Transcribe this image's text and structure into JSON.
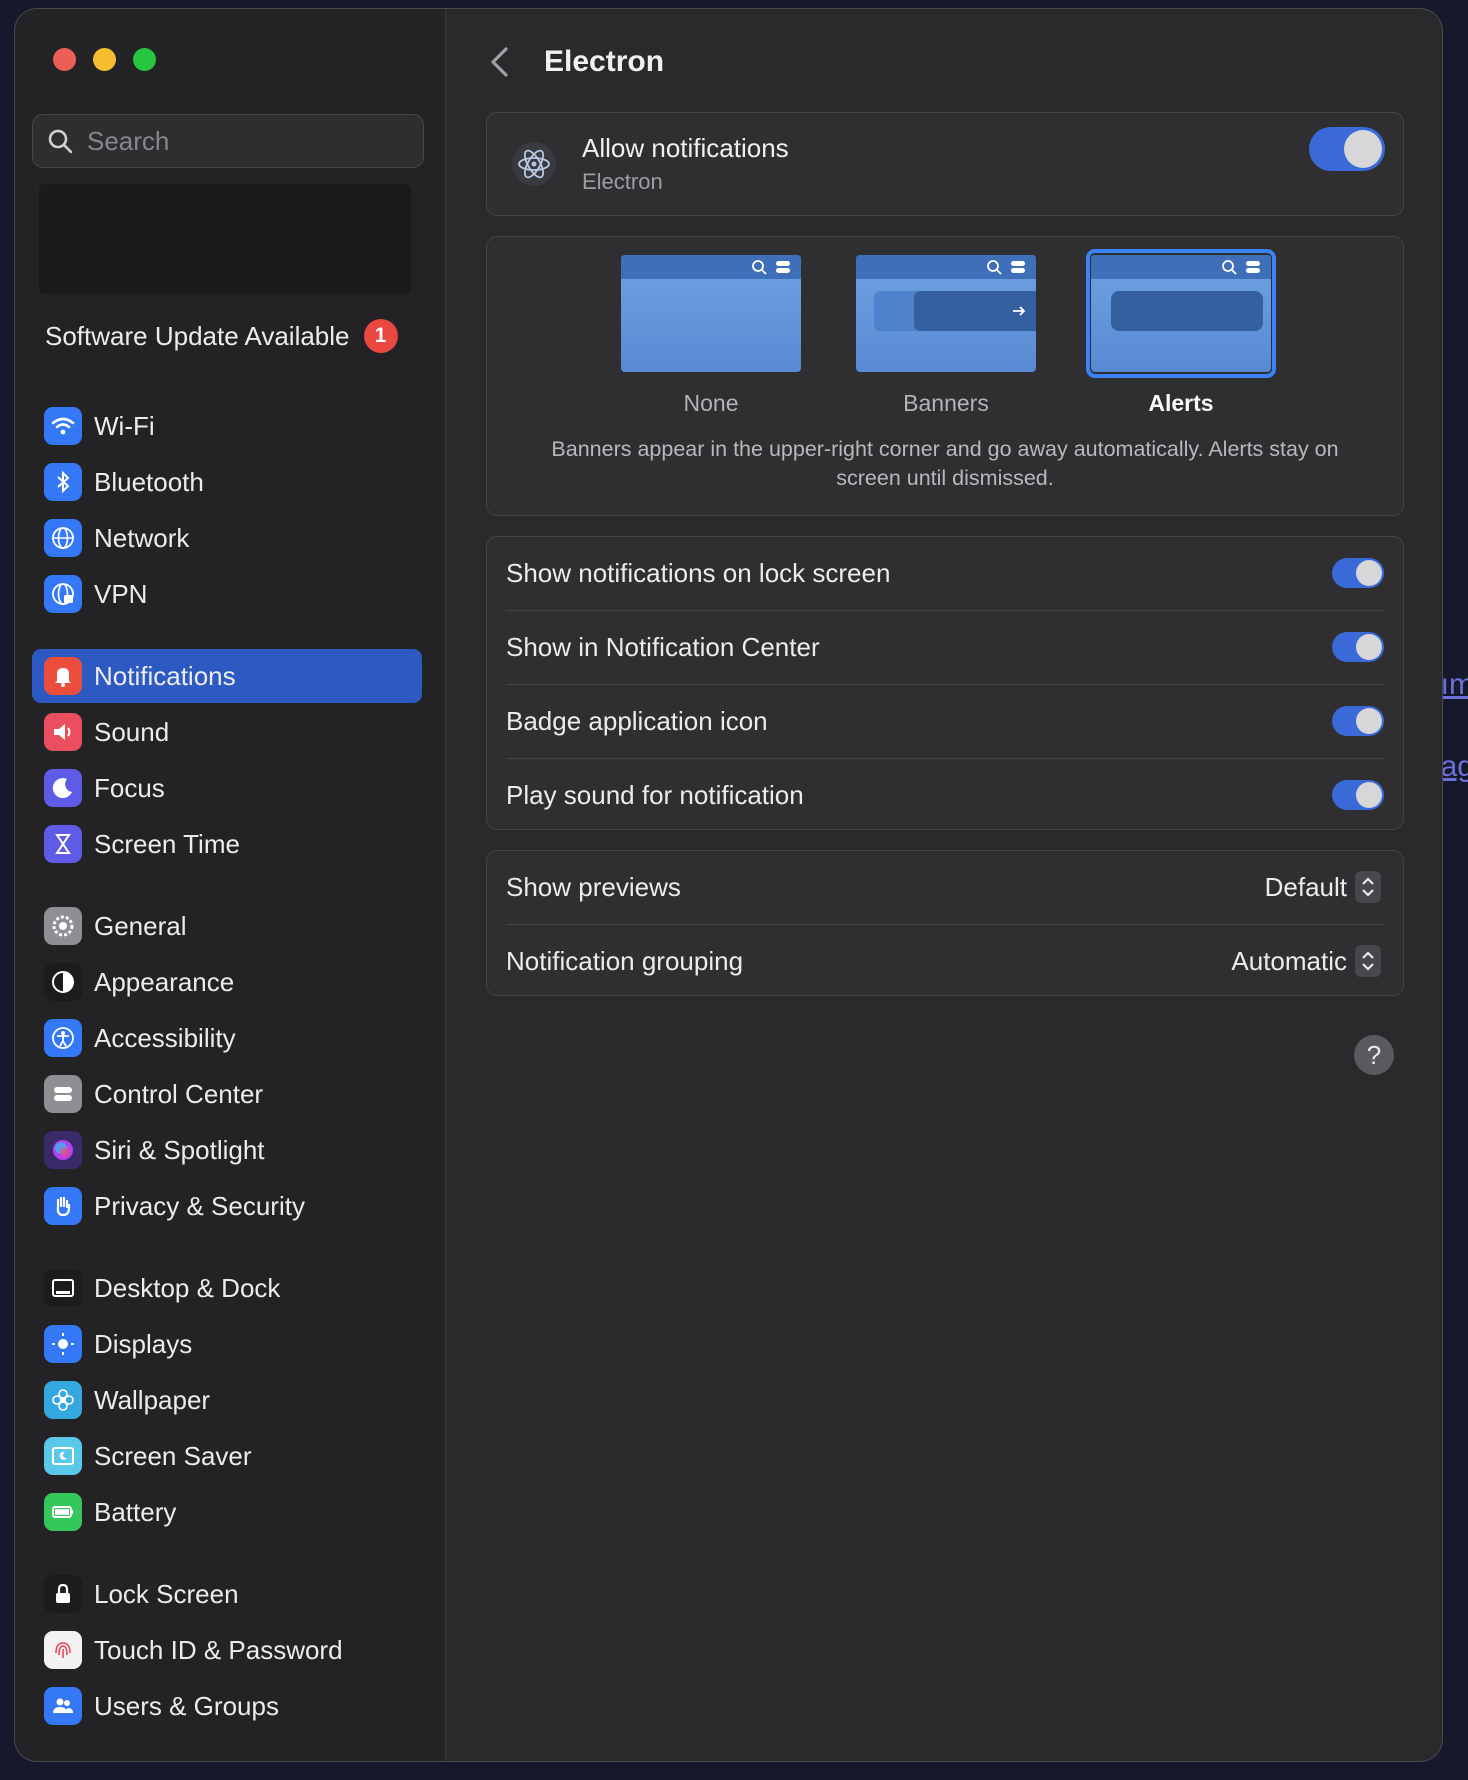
{
  "window": {
    "title": "Electron"
  },
  "search": {
    "placeholder": "Search"
  },
  "software_update": {
    "label": "Software Update Available",
    "count": "1"
  },
  "sidebar": {
    "items": [
      {
        "label": "Wi-Fi",
        "icon": "wifi-icon",
        "color": "#3478f6"
      },
      {
        "label": "Bluetooth",
        "icon": "bluetooth-icon",
        "color": "#3478f6"
      },
      {
        "label": "Network",
        "icon": "globe-icon",
        "color": "#3478f6"
      },
      {
        "label": "VPN",
        "icon": "vpn-globe-icon",
        "color": "#3478f6"
      },
      {
        "label": "Notifications",
        "icon": "bell-icon",
        "color": "#eb4e3d",
        "selected": true
      },
      {
        "label": "Sound",
        "icon": "speaker-icon",
        "color": "#eb4e5e"
      },
      {
        "label": "Focus",
        "icon": "moon-icon",
        "color": "#5e5ce6"
      },
      {
        "label": "Screen Time",
        "icon": "hourglass-icon",
        "color": "#5e5ce6"
      },
      {
        "label": "General",
        "icon": "gear-icon",
        "color": "#8e8e93"
      },
      {
        "label": "Appearance",
        "icon": "appearance-icon",
        "color": "#1c1c1e"
      },
      {
        "label": "Accessibility",
        "icon": "accessibility-icon",
        "color": "#3478f6"
      },
      {
        "label": "Control Center",
        "icon": "control-center-icon",
        "color": "#8e8e93"
      },
      {
        "label": "Siri & Spotlight",
        "icon": "siri-icon",
        "color": "#3a2a6a"
      },
      {
        "label": "Privacy & Security",
        "icon": "hand-icon",
        "color": "#3478f6"
      },
      {
        "label": "Desktop & Dock",
        "icon": "dock-icon",
        "color": "#1c1c1e"
      },
      {
        "label": "Displays",
        "icon": "sun-icon",
        "color": "#3478f6"
      },
      {
        "label": "Wallpaper",
        "icon": "flower-icon",
        "color": "#35a8e0"
      },
      {
        "label": "Screen Saver",
        "icon": "screen-saver-icon",
        "color": "#5ac8e8"
      },
      {
        "label": "Battery",
        "icon": "battery-icon",
        "color": "#34c759"
      },
      {
        "label": "Lock Screen",
        "icon": "lock-icon",
        "color": "#1c1c1e"
      },
      {
        "label": "Touch ID & Password",
        "icon": "fingerprint-icon",
        "color": "#f2f2f2"
      },
      {
        "label": "Users & Groups",
        "icon": "users-icon",
        "color": "#3478f6"
      }
    ]
  },
  "allow": {
    "title": "Allow notifications",
    "subtitle": "Electron",
    "on": true
  },
  "styles": {
    "options": [
      {
        "label": "None"
      },
      {
        "label": "Banners"
      },
      {
        "label": "Alerts",
        "selected": true
      }
    ],
    "description": "Banners appear in the upper-right corner and go away automatically. Alerts stay on screen until dismissed."
  },
  "toggles": [
    {
      "label": "Show notifications on lock screen",
      "on": true
    },
    {
      "label": "Show in Notification Center",
      "on": true
    },
    {
      "label": "Badge application icon",
      "on": true
    },
    {
      "label": "Play sound for notification",
      "on": true
    }
  ],
  "selects": [
    {
      "label": "Show previews",
      "value": "Default"
    },
    {
      "label": "Notification grouping",
      "value": "Automatic"
    }
  ],
  "help": {
    "label": "?"
  },
  "edge_fragments": [
    "ım",
    "ag"
  ],
  "colors": {
    "accent": "#2d59c3",
    "toggle_on": "#3a6ad7",
    "selection_frame": "#3b82f6"
  }
}
